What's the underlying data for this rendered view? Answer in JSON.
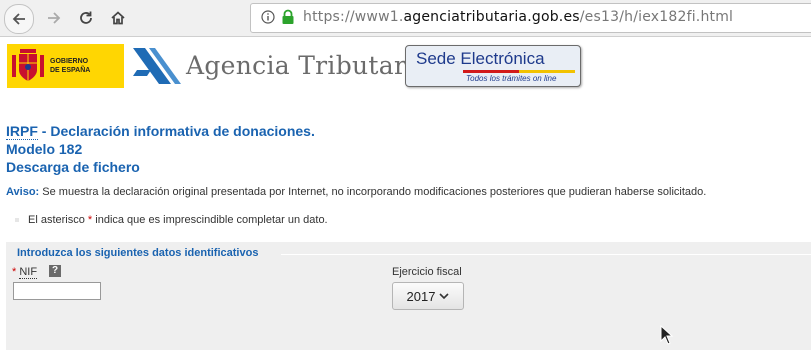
{
  "browser": {
    "url_prefix": "https://www1.",
    "url_domain": "agenciatributaria.gob.es",
    "url_path": "/es13/h/iex182fi.html"
  },
  "header": {
    "gov_logo_line1": "GOBIERNO",
    "gov_logo_line2": "DE ESPAÑA",
    "agency_name": "Agencia Tributaria",
    "sede_title": "Sede Electrónica",
    "sede_subtitle": "Todos los trámites on line",
    "gov_yellow": "#ffd602",
    "brand_blue": "#1a63b0"
  },
  "page": {
    "title_abbr": "IRPF",
    "title_rest": " - Declaración informativa de donaciones.",
    "title_line2": "Modelo 182",
    "title_line3": "Descarga de fichero",
    "notice_label": "Aviso:",
    "notice_text": " Se muestra la declaración original presentada por Internet, no incorporando modificaciones posteriores que pudieran haberse solicitado.",
    "asterisk_pre": "El asterisco ",
    "asterisk_mark": "*",
    "asterisk_post": " indica que es imprescindible completar un dato."
  },
  "form": {
    "section_title": "Introduzca los siguientes datos identificativos",
    "nif_required_mark": "*",
    "nif_label": "NIF",
    "nif_help": "?",
    "nif_value": "",
    "ejercicio_label": "Ejercicio fiscal",
    "ejercicio_selected": "2017"
  }
}
